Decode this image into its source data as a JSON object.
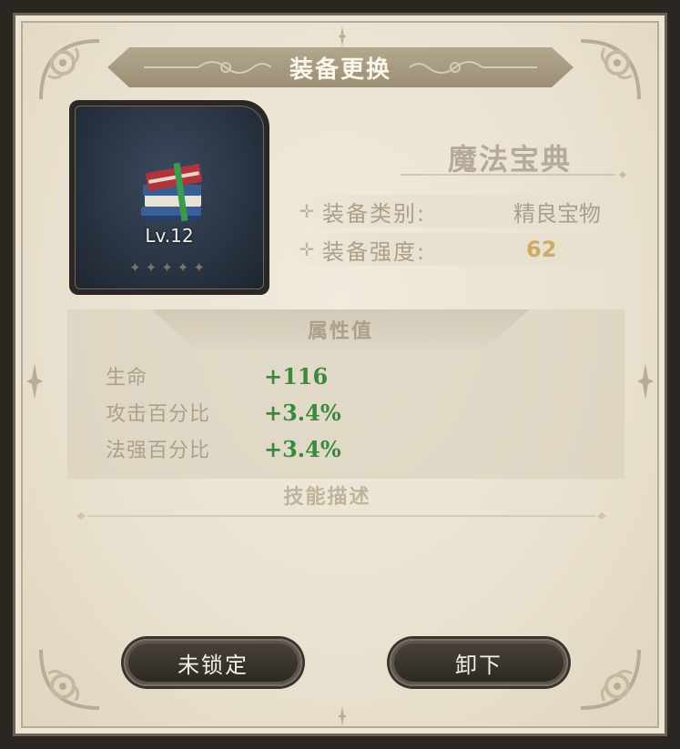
{
  "header": {
    "title": "装备更换"
  },
  "item": {
    "level_label": "Lv.12",
    "stars": "✦✦✦✦✦",
    "name": "魔法宝典",
    "icon": "magic-book-icon"
  },
  "details": [
    {
      "label": "装备类别:",
      "value": "精良宝物"
    },
    {
      "label": "装备强度:",
      "value": "62"
    }
  ],
  "attributes": {
    "title": "属性值",
    "stats": [
      {
        "name": "生命",
        "value": "+116"
      },
      {
        "name": "攻击百分比",
        "value": "+3.4%"
      },
      {
        "name": "法强百分比",
        "value": "+3.4%"
      }
    ]
  },
  "skill": {
    "title": "技能描述",
    "description": ""
  },
  "buttons": {
    "lock": "未锁定",
    "unequip": "卸下"
  },
  "colors": {
    "stat_green": "#3a8a3c",
    "strength_gold": "#cfa966",
    "panel_bg": "#ede6d6"
  }
}
